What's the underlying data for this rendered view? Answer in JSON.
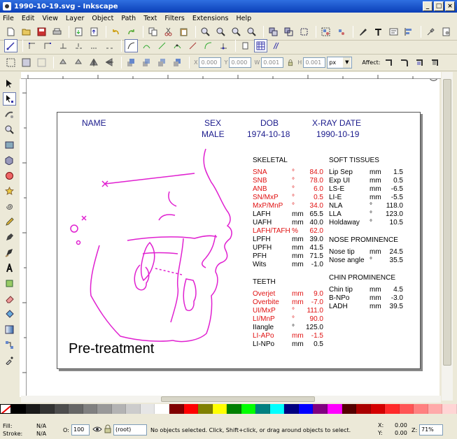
{
  "window": {
    "title": "1990-10-19.svg - Inkscape"
  },
  "menu": [
    "File",
    "Edit",
    "View",
    "Layer",
    "Object",
    "Path",
    "Text",
    "Filters",
    "Extensions",
    "Help"
  ],
  "select_toolbar": {
    "x_label": "X",
    "x_value": "0.000",
    "y_label": "Y",
    "y_value": "0.000",
    "w_label": "W",
    "w_value": "0.001",
    "h_label": "H",
    "h_value": "0.001",
    "unit": "px",
    "affect_label": "Affect:"
  },
  "header": {
    "name_label": "NAME",
    "sex_label": "SEX",
    "sex_value": "MALE",
    "dob_label": "DOB",
    "dob_value": "1974-10-18",
    "xray_label": "X-RAY DATE",
    "xray_value": "1990-10-19"
  },
  "skeletal": {
    "title": "SKELETAL",
    "rows": [
      {
        "name": "SNA",
        "unit": "°",
        "value": "84.0",
        "red": true
      },
      {
        "name": "SNB",
        "unit": "°",
        "value": "78.0",
        "red": true
      },
      {
        "name": "ANB",
        "unit": "°",
        "value": "6.0",
        "red": true
      },
      {
        "name": "SN/MxP",
        "unit": "°",
        "value": "0.5",
        "red": true
      },
      {
        "name": "MxP/MnP",
        "unit": "°",
        "value": "34.0",
        "red": true
      },
      {
        "name": "LAFH",
        "unit": "mm",
        "value": "65.5",
        "red": false
      },
      {
        "name": "UAFH",
        "unit": "mm",
        "value": "40.0",
        "red": false
      },
      {
        "name": "LAFH/TAFH",
        "unit": "%",
        "value": "62.0",
        "red": true
      },
      {
        "name": "LPFH",
        "unit": "mm",
        "value": "39.0",
        "red": false
      },
      {
        "name": "UPFH",
        "unit": "mm",
        "value": "41.5",
        "red": false
      },
      {
        "name": "PFH",
        "unit": "mm",
        "value": "71.5",
        "red": false
      },
      {
        "name": "Wits",
        "unit": "mm",
        "value": "-1.0",
        "red": false
      }
    ]
  },
  "teeth": {
    "title": "TEETH",
    "rows": [
      {
        "name": "Overjet",
        "unit": "mm",
        "value": "9.0",
        "red": true
      },
      {
        "name": "Overbite",
        "unit": "mm",
        "value": "-7.0",
        "red": true
      },
      {
        "name": "UI/MxP",
        "unit": "°",
        "value": "111.0",
        "red": true
      },
      {
        "name": "LI/MnP",
        "unit": "°",
        "value": "90.0",
        "red": true
      },
      {
        "name": "IIangle",
        "unit": "°",
        "value": "125.0",
        "red": false
      },
      {
        "name": "LI-APo",
        "unit": "mm",
        "value": "-1.5",
        "red": true
      },
      {
        "name": "LI-NPo",
        "unit": "mm",
        "value": "0.5",
        "red": false
      }
    ]
  },
  "soft_tissues": {
    "title": "SOFT TISSUES",
    "rows": [
      {
        "name": "Lip Sep",
        "unit": "mm",
        "value": "1.5"
      },
      {
        "name": "Exp UI",
        "unit": "mm",
        "value": "0.5"
      },
      {
        "name": "LS-E",
        "unit": "mm",
        "value": "-6.5"
      },
      {
        "name": "LI-E",
        "unit": "mm",
        "value": "-5.5"
      },
      {
        "name": "NLA",
        "unit": "°",
        "value": "118.0"
      },
      {
        "name": "LLA",
        "unit": "°",
        "value": "123.0"
      },
      {
        "name": "Holdaway",
        "unit": "°",
        "value": "10.5"
      }
    ]
  },
  "nose": {
    "title": "NOSE PROMINENCE",
    "rows": [
      {
        "name": "Nose tip",
        "unit": "mm",
        "value": "24.5"
      },
      {
        "name": "Nose angle",
        "unit": "°",
        "value": "35.5"
      }
    ]
  },
  "chin": {
    "title": "CHIN PROMINENCE",
    "rows": [
      {
        "name": "Chin tip",
        "unit": "mm",
        "value": "4.5"
      },
      {
        "name": "B-NPo",
        "unit": "mm",
        "value": "-3.0"
      },
      {
        "name": "LADH",
        "unit": "mm",
        "value": "39.5"
      }
    ]
  },
  "caption": "Pre-treatment",
  "palette": [
    "#000000",
    "#1a1a1a",
    "#333333",
    "#4d4d4d",
    "#666666",
    "#808080",
    "#999999",
    "#b3b3b3",
    "#cccccc",
    "#e6e6e6",
    "#ffffff",
    "#800000",
    "#ff0000",
    "#808000",
    "#ffff00",
    "#008000",
    "#00ff00",
    "#008080",
    "#00ffff",
    "#000080",
    "#0000ff",
    "#800080",
    "#ff00ff",
    "#550000",
    "#aa0000",
    "#d40000",
    "#ff2a2a",
    "#ff5555",
    "#ff8080",
    "#ffaaaa",
    "#ffd5d5"
  ],
  "status": {
    "fill_label": "Fill:",
    "fill_value": "N/A",
    "stroke_label": "Stroke:",
    "stroke_value": "N/A",
    "opacity_label": "O:",
    "opacity_value": "100",
    "layer_value": "(root)",
    "message": "No objects selected. Click, Shift+click, or drag around objects to select.",
    "x_label": "X:",
    "x_value": "0.00",
    "y_label": "Y:",
    "y_value": "0.00",
    "zoom_label": "Z:",
    "zoom_value": "71%"
  }
}
